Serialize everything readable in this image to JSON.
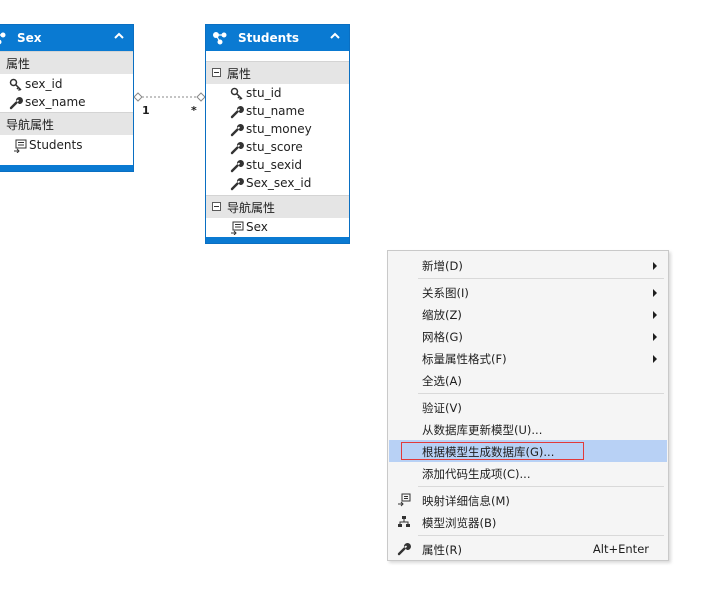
{
  "sex_entity": {
    "title": "Sex",
    "properties_label": "属性",
    "properties": [
      "sex_id",
      "sex_name"
    ],
    "nav_label": "导航属性",
    "nav_properties": [
      "Students"
    ]
  },
  "students_entity": {
    "title": "Students",
    "properties_label": "属性",
    "properties": [
      "stu_id",
      "stu_name",
      "stu_money",
      "stu_score",
      "stu_sexid",
      "Sex_sex_id"
    ],
    "nav_label": "导航属性",
    "nav_properties": [
      "Sex"
    ]
  },
  "association": {
    "left_multiplicity": "1",
    "right_multiplicity": "*"
  },
  "context_menu": {
    "items": [
      {
        "label": "新增(D)",
        "submenu": true
      },
      {
        "label": "关系图(I)",
        "submenu": true
      },
      {
        "label": "缩放(Z)",
        "submenu": true
      },
      {
        "label": "网格(G)",
        "submenu": true
      },
      {
        "label": "标量属性格式(F)",
        "submenu": true
      },
      {
        "label": "全选(A)"
      },
      {
        "label": "验证(V)"
      },
      {
        "label": "从数据库更新模型(U)..."
      },
      {
        "label": "根据模型生成数据库(G)...",
        "highlighted": true
      },
      {
        "label": "添加代码生成项(C)..."
      },
      {
        "label": "映射详细信息(M)",
        "icon": "mapping-details-icon"
      },
      {
        "label": "模型浏览器(B)",
        "icon": "model-browser-icon"
      },
      {
        "label": "属性(R)",
        "icon": "wrench-icon",
        "shortcut": "Alt+Enter"
      }
    ]
  },
  "colors": {
    "header_blue": "#0a7ad2",
    "highlight": "#b8d1f5",
    "red_box": "#e23a3a"
  }
}
